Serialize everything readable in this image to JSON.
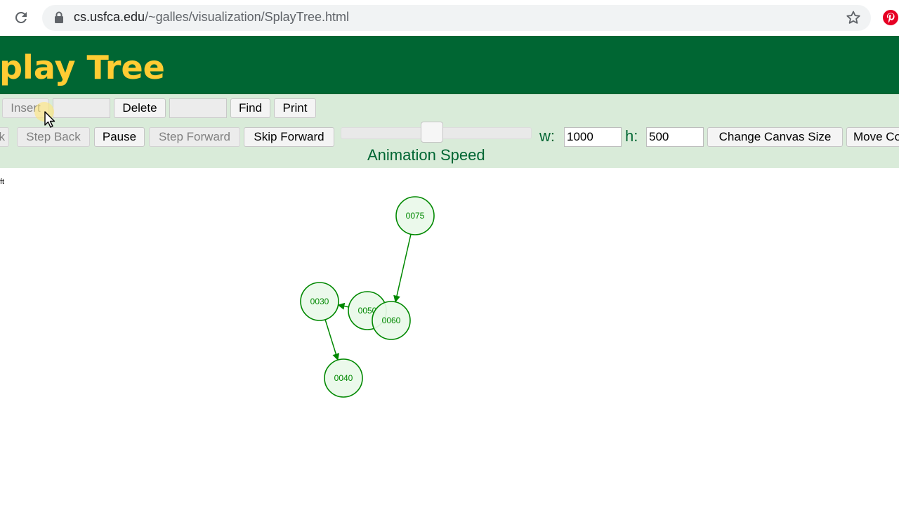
{
  "browser": {
    "url_host": "cs.usfca.edu",
    "url_path": "/~galles/visualization/SplayTree.html"
  },
  "header": {
    "title": "Splay Tree"
  },
  "algorithm_controls": {
    "insert_label": "Insert",
    "delete_label": "Delete",
    "find_label": "Find",
    "print_label": "Print"
  },
  "animation_controls": {
    "skip_back_partial": "k",
    "step_back_label": "Step Back",
    "pause_label": "Pause",
    "step_forward_label": "Step Forward",
    "skip_forward_label": "Skip Forward",
    "speed_label": "Animation Speed",
    "speed_value": 0.5,
    "width_label": "w:",
    "width_value": "1000",
    "height_label": "h:",
    "height_value": "500",
    "change_canvas_label": "Change Canvas Size",
    "move_controls_partial": "Move Co"
  },
  "canvas": {
    "left_caption": "ft",
    "nodes": [
      {
        "key": "n75",
        "label": "0075"
      },
      {
        "key": "n30",
        "label": "0030"
      },
      {
        "key": "n50",
        "label": "0050"
      },
      {
        "key": "n60",
        "label": "0060"
      },
      {
        "key": "n40",
        "label": "0040"
      }
    ],
    "edges": [
      {
        "from": "n75",
        "to": "n60"
      },
      {
        "from": "n50",
        "to": "n30"
      },
      {
        "from": "n50",
        "to": "n60"
      },
      {
        "from": "n30",
        "to": "n40"
      }
    ],
    "node_color": "#008800",
    "node_fill": "#e9f8e9"
  }
}
